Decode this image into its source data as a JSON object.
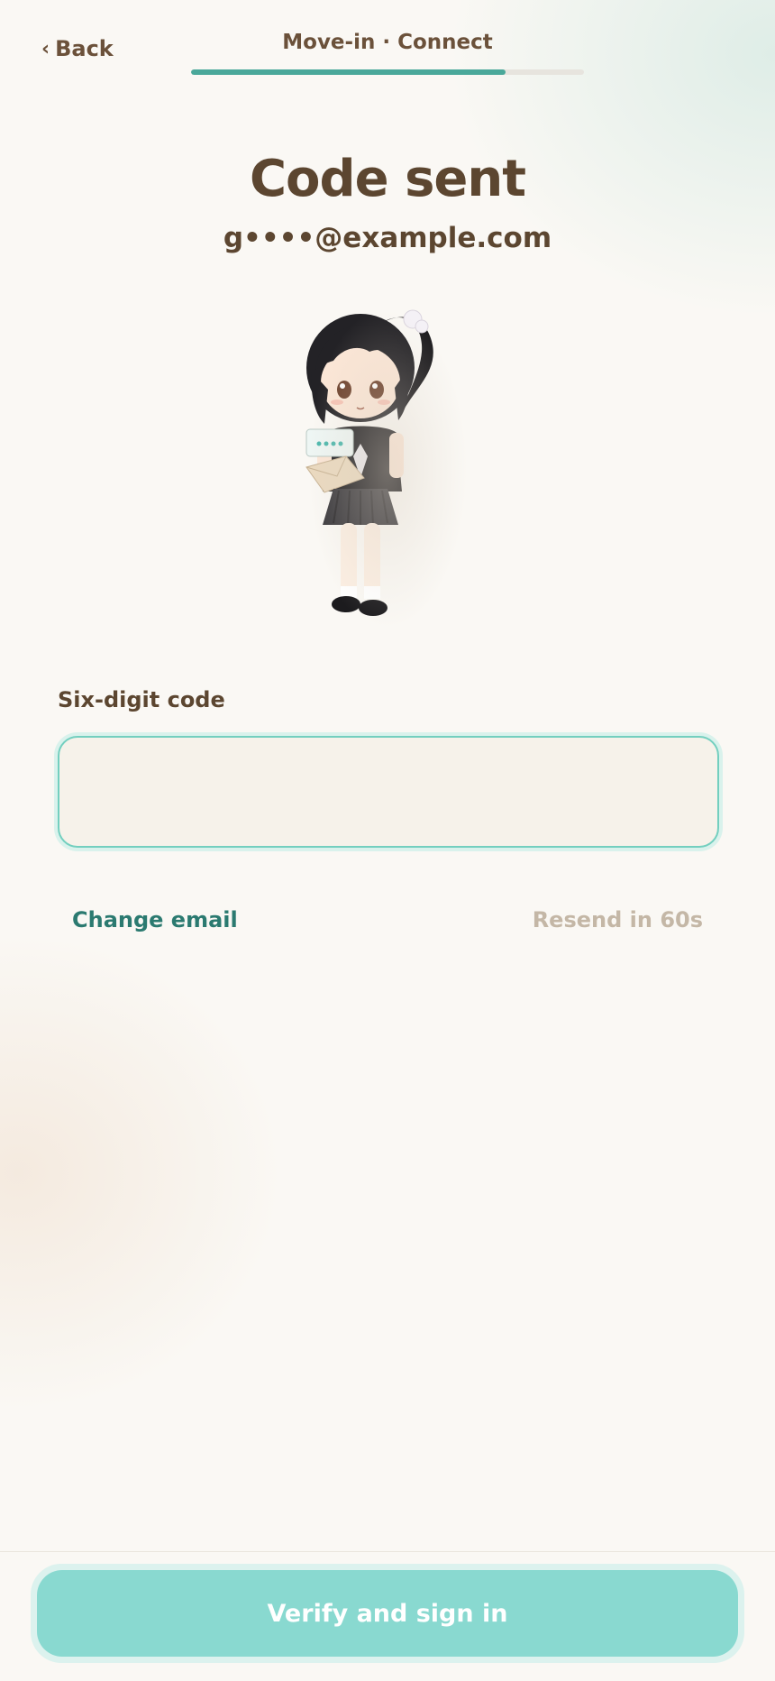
{
  "header": {
    "back_label": "Back",
    "back_icon": "chevron-left-icon",
    "step_title": "Move-in · Connect",
    "progress": 0.8
  },
  "main": {
    "title": "Code sent",
    "email": "g••••@example.com",
    "mascot": "girl-holding-envelope-illustration",
    "code_field": {
      "label": "Six-digit code",
      "value": "",
      "placeholder": ""
    },
    "change_email_label": "Change email",
    "resend_label": "Resend in 60s"
  },
  "footer": {
    "primary_button_label": "Verify and sign in"
  },
  "colors": {
    "accent": "#4aa89a",
    "link": "#2b7a70",
    "button": "#89d9d0",
    "text": "#5c4630",
    "muted": "#c4b7a6"
  }
}
